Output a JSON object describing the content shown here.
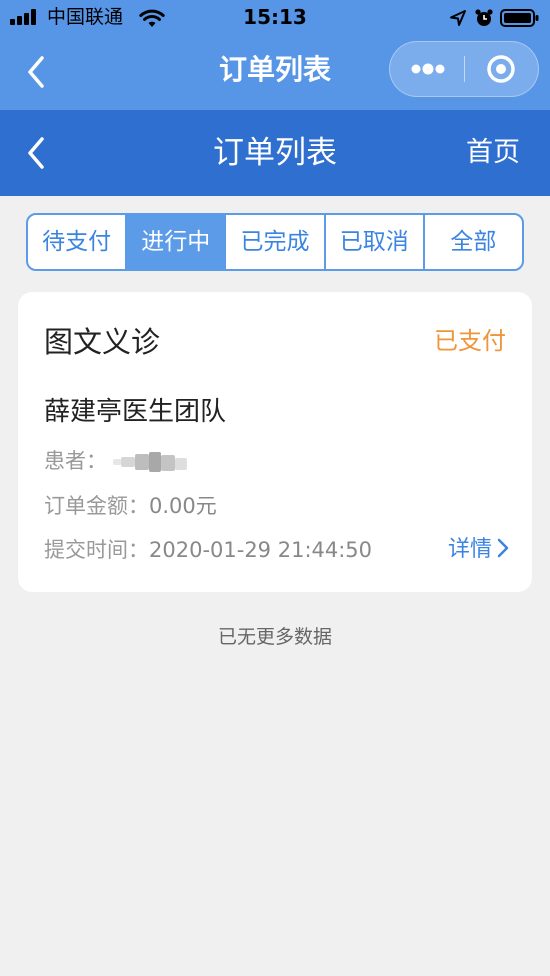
{
  "status_bar": {
    "carrier": "中国联通",
    "time": "15:13"
  },
  "miniprogram_bar": {
    "title": "订单列表"
  },
  "page_header": {
    "title": "订单列表",
    "home_label": "首页"
  },
  "tabs": [
    {
      "label": "待支付",
      "active": false
    },
    {
      "label": "进行中",
      "active": true
    },
    {
      "label": "已完成",
      "active": false
    },
    {
      "label": "已取消",
      "active": false
    },
    {
      "label": "全部",
      "active": false
    }
  ],
  "orders": [
    {
      "service_type": "图文义诊",
      "status": "已支付",
      "team_name": "薛建亭医生团队",
      "patient_label": "患者：",
      "amount_label": "订单金额：",
      "amount": "0.00元",
      "time_label": "提交时间：",
      "submit_time": "2020-01-29 21:44:50",
      "details_label": "详情"
    }
  ],
  "list_footer": "已无更多数据",
  "colors": {
    "nav_top": "#5795e6",
    "header": "#2f6fd0",
    "tab_accent": "#5b9be8",
    "status_paid": "#f0953a",
    "link": "#3b84e0",
    "page_bg": "#f0f0f0"
  },
  "icons": [
    "signal-icon",
    "wifi-icon",
    "location-arrow-icon",
    "alarm-icon",
    "battery-icon",
    "back-chevron-icon",
    "more-dots-icon",
    "close-circle-icon",
    "chevron-right-icon"
  ]
}
